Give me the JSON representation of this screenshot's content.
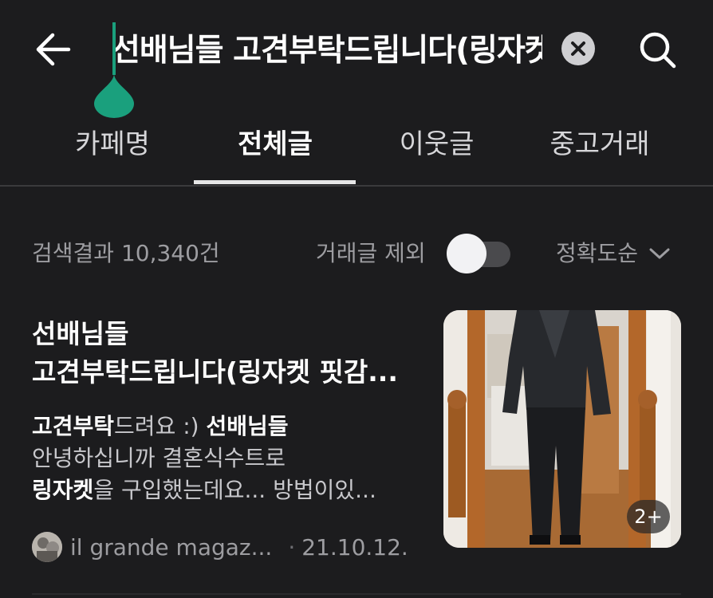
{
  "search": {
    "query": "선배님들 고견부탁드립니다(링자켓 핏감 좀 봐주세요)"
  },
  "tabs": [
    {
      "label": "카페명"
    },
    {
      "label": "전체글"
    },
    {
      "label": "이웃글"
    },
    {
      "label": "중고거래"
    }
  ],
  "active_tab": "전체글",
  "filter": {
    "result_count": "검색결과 10,340건",
    "exclude_trade_label": "거래글 제외",
    "exclude_trade_on": false,
    "sort_label": "정확도순"
  },
  "article": {
    "title_line1": "선배님들",
    "title_line2": "고견부탁드립니다(링자켓 핏감...",
    "body_line1_highlight": "고견부탁",
    "body_line1_rest": "드려요 :) ",
    "body_line1_highlight2": "선배님들",
    "body_line2": "안녕하십니까 결혼식수트로",
    "body_line3_highlight": "링자켓",
    "body_line3_rest": "을 구입했는데요... 방법이있...",
    "author": "il grande magaz...",
    "date": "21.10.12.",
    "image_count": "2+"
  },
  "colors": {
    "background": "#1c1c1e",
    "accent_green": "#1aa07d",
    "secondary_text": "#9d9da1"
  },
  "icons": [
    "arrow-left-icon",
    "clear-icon",
    "search-icon",
    "chevron-down-icon"
  ]
}
